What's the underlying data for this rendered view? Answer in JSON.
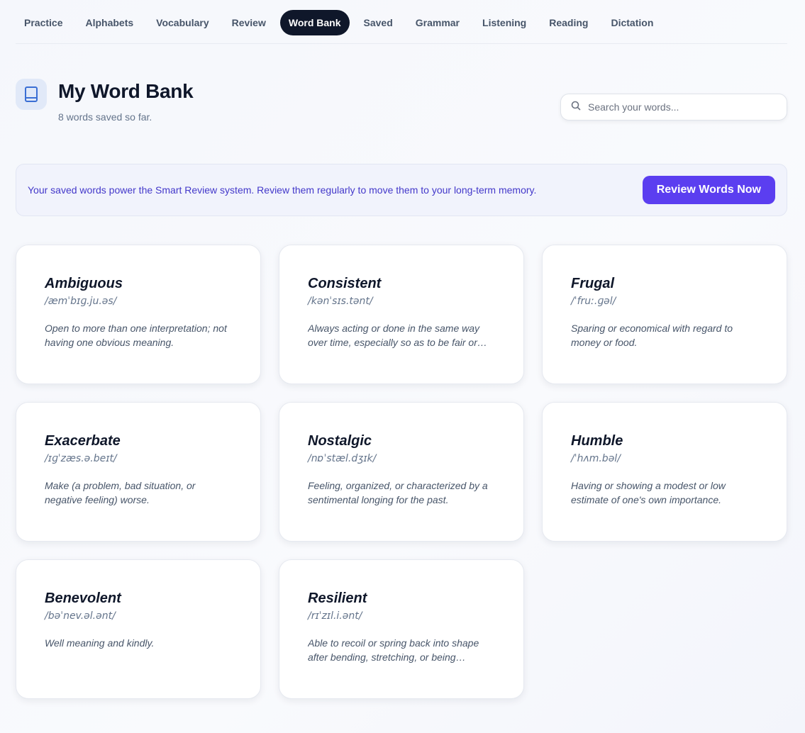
{
  "nav": {
    "items": [
      {
        "label": "Practice"
      },
      {
        "label": "Alphabets"
      },
      {
        "label": "Vocabulary"
      },
      {
        "label": "Review"
      },
      {
        "label": "Word Bank"
      },
      {
        "label": "Saved"
      },
      {
        "label": "Grammar"
      },
      {
        "label": "Listening"
      },
      {
        "label": "Reading"
      },
      {
        "label": "Dictation"
      }
    ],
    "active": "Word Bank"
  },
  "header": {
    "title": "My Word Bank",
    "subtitle": "8 words saved so far.",
    "icon": "book-icon"
  },
  "search": {
    "placeholder": "Search your words...",
    "value": "",
    "icon": "search-icon"
  },
  "banner": {
    "text": "Your saved words power the Smart Review system. Review them regularly to move them to your long-term memory.",
    "button_label": "Review Words Now"
  },
  "words": [
    {
      "word": "Ambiguous",
      "ipa": "/æmˈbɪɡ.ju.əs/",
      "definition": "Open to more than one interpretation; not having one obvious meaning."
    },
    {
      "word": "Consistent",
      "ipa": "/kənˈsɪs.tənt/",
      "definition": "Always acting or done in the same way over time, especially so as to be fair or accurate."
    },
    {
      "word": "Frugal",
      "ipa": "/ˈfruː.ɡəl/",
      "definition": "Sparing or economical with regard to money or food."
    },
    {
      "word": "Exacerbate",
      "ipa": "/ɪɡˈzæs.ə.beɪt/",
      "definition": "Make (a problem, bad situation, or negative feeling) worse."
    },
    {
      "word": "Nostalgic",
      "ipa": "/nɒˈstæl.dʒɪk/",
      "definition": "Feeling, organized, or characterized by a sentimental longing for the past."
    },
    {
      "word": "Humble",
      "ipa": "/ˈhʌm.bəl/",
      "definition": "Having or showing a modest or low estimate of one's own importance."
    },
    {
      "word": "Benevolent",
      "ipa": "/bəˈnev.əl.ənt/",
      "definition": "Well meaning and kindly."
    },
    {
      "word": "Resilient",
      "ipa": "/rɪˈzɪl.i.ənt/",
      "definition": "Able to recoil or spring back into shape after bending, stretching, or being compressed."
    }
  ],
  "colors": {
    "accent": "#5b3ef0",
    "nav_active_bg": "#0f172a",
    "banner_text": "#4338ca",
    "icon_blue": "#3b6fd4"
  }
}
